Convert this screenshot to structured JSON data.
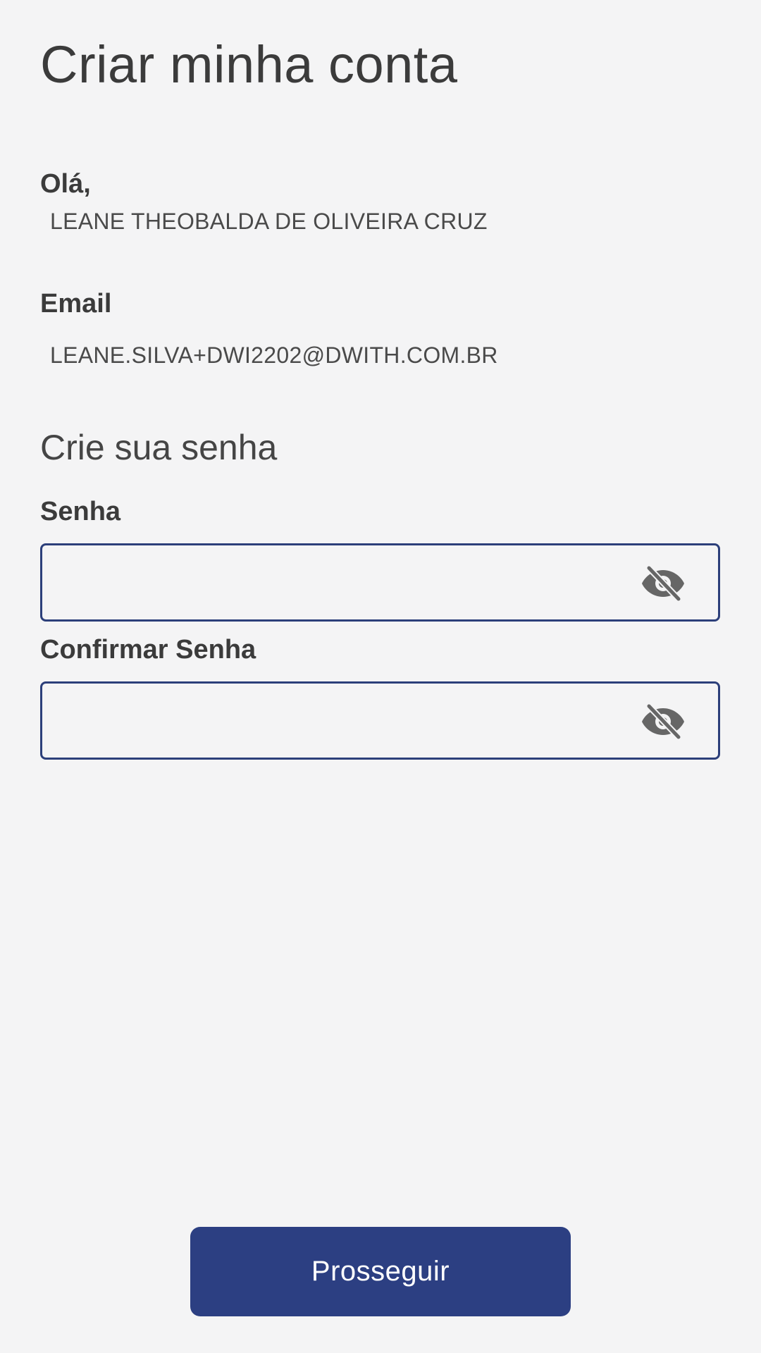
{
  "header": {
    "title": "Criar minha conta"
  },
  "user": {
    "greeting_label": "Olá,",
    "name": "LEANE THEOBALDA DE OLIVEIRA CRUZ",
    "email_label": "Email",
    "email": "LEANE.SILVA+DWI2202@DWITH.COM.BR"
  },
  "password_section": {
    "title": "Crie sua senha",
    "password_label": "Senha",
    "password_value": "",
    "confirm_label": "Confirmar Senha",
    "confirm_value": "",
    "toggle_icon": "eye-off-icon"
  },
  "actions": {
    "submit_label": "Prosseguir"
  },
  "colors": {
    "background": "#f4f4f5",
    "accent": "#2c3f82",
    "input_border": "#2c3f7a",
    "icon": "#666666"
  }
}
